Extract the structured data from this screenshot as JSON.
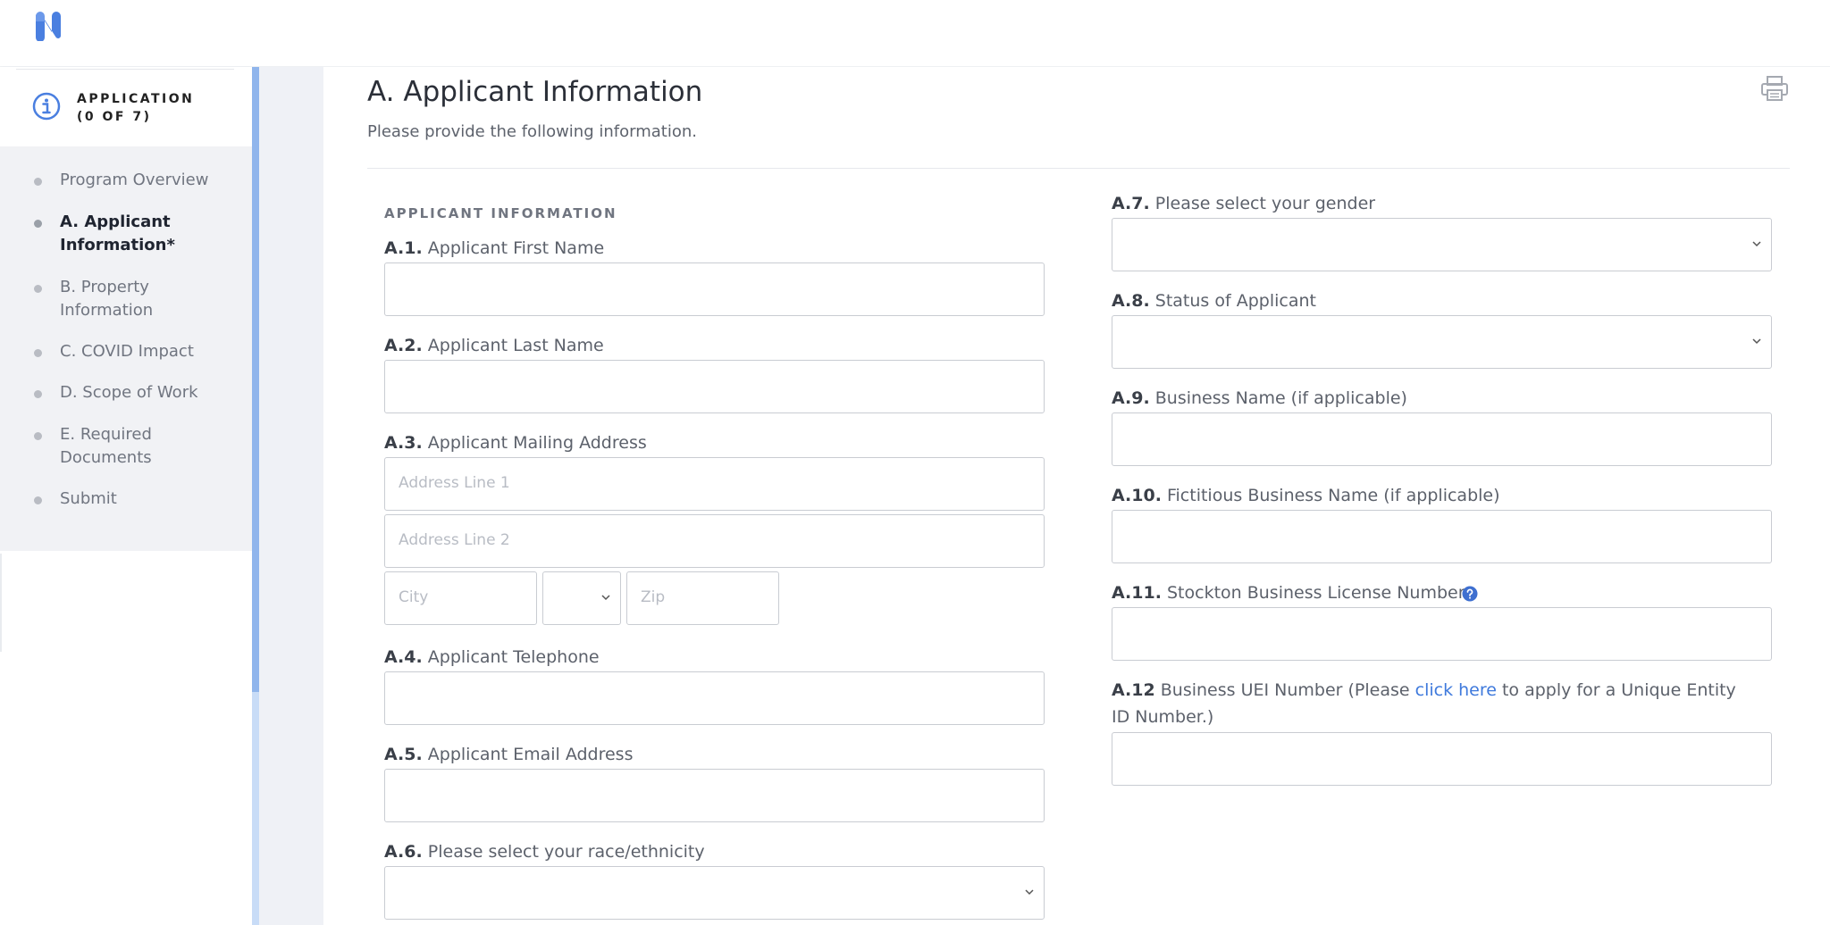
{
  "app": {
    "logo_letter": "N",
    "brand_color": "#4a7fe0"
  },
  "sidebar": {
    "header_line1": "APPLICATION",
    "header_line2": "(0 OF 7)",
    "items": [
      {
        "label": "Program Overview",
        "active": false
      },
      {
        "label": "A. Applicant",
        "label2": "Information*",
        "active": true
      },
      {
        "label": "B. Property",
        "label2": "Information",
        "active": false
      },
      {
        "label": "C. COVID Impact",
        "active": false
      },
      {
        "label": "D. Scope of Work",
        "active": false
      },
      {
        "label": "E. Required",
        "label2": "Documents",
        "active": false
      },
      {
        "label": "Submit",
        "active": false
      }
    ]
  },
  "main": {
    "title": "A. Applicant Information",
    "subtitle": "Please provide the following information.",
    "section_label": "APPLICANT INFORMATION",
    "fields": {
      "a1": {
        "num": "A.1.",
        "label": "Applicant First Name",
        "value": ""
      },
      "a2": {
        "num": "A.2.",
        "label": "Applicant Last Name",
        "value": ""
      },
      "a3": {
        "num": "A.3.",
        "label": "Applicant Mailing Address",
        "address1_placeholder": "Address Line 1",
        "address2_placeholder": "Address Line 2",
        "city_placeholder": "City",
        "state_value": "",
        "zip_placeholder": "Zip"
      },
      "a4": {
        "num": "A.4.",
        "label": "Applicant Telephone",
        "value": ""
      },
      "a5": {
        "num": "A.5.",
        "label": "Applicant Email Address",
        "value": ""
      },
      "a6": {
        "num": "A.6.",
        "label": "Please select your race/ethnicity",
        "value": ""
      },
      "a7": {
        "num": "A.7.",
        "label": "Please select your gender",
        "value": ""
      },
      "a8": {
        "num": "A.8.",
        "label": "Status of Applicant",
        "value": ""
      },
      "a9": {
        "num": "A.9.",
        "label": "Business Name (if applicable)",
        "value": ""
      },
      "a10": {
        "num": "A.10.",
        "label": "Fictitious Business Name (if applicable)",
        "value": ""
      },
      "a11": {
        "num": "A.11.",
        "label": "Stockton Business License Number",
        "value": ""
      },
      "a12": {
        "num": "A.12",
        "label_before": "Business UEI Number (Please",
        "link_text": "click here",
        "label_after": "to apply for a Unique Entity ID Number.)",
        "value": ""
      }
    }
  },
  "icons": {
    "info": "info-circle-icon",
    "print": "printer-icon",
    "help": "question-circle-icon",
    "chevron": "chevron-down-icon"
  }
}
